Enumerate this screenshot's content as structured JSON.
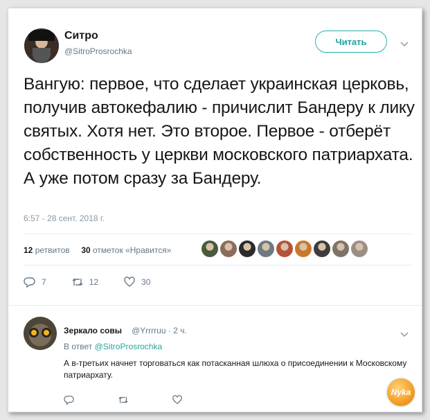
{
  "tweet": {
    "author_name": "Ситро",
    "author_handle": "@SitroProsrochka",
    "follow_label": "Читать",
    "text": "Вангую: первое, что сделает украинская церковь, получив автокефалию - причислит Бандеру к лику святых. Хотя нет. Это второе. Первое - отберёт собственность у церкви московского патриархата. А уже потом сразу за Бандеру.",
    "timestamp": "6:57 - 28 сент. 2018 г.",
    "retweets_count": "12",
    "retweets_label": "ретвитов",
    "likes_count": "30",
    "likes_label": "отметок «Нравится»",
    "actions": {
      "reply_count": "7",
      "retweet_count": "12",
      "like_count": "30"
    },
    "liker_colors": [
      "#4a5a3c",
      "#8d6b5a",
      "#2b2b2b",
      "#6d7a80",
      "#b5523a",
      "#c9782a",
      "#3d3d3d",
      "#7c7466",
      "#9a8f85"
    ]
  },
  "reply": {
    "author_name": "Зеркало совы",
    "author_handle": "@Yrrrruu",
    "time": "· 2 ч.",
    "reply_to_prefix": "В ответ",
    "reply_to_handle": "@SitroProsrochka",
    "text": "А в-третьих начнет торговаться как потасканная шлюха о присоединении к Московскому патриархату."
  },
  "watermark_text": "Nyka",
  "colors": {
    "accent": "#26b0a8",
    "link": "#26a4a0"
  }
}
